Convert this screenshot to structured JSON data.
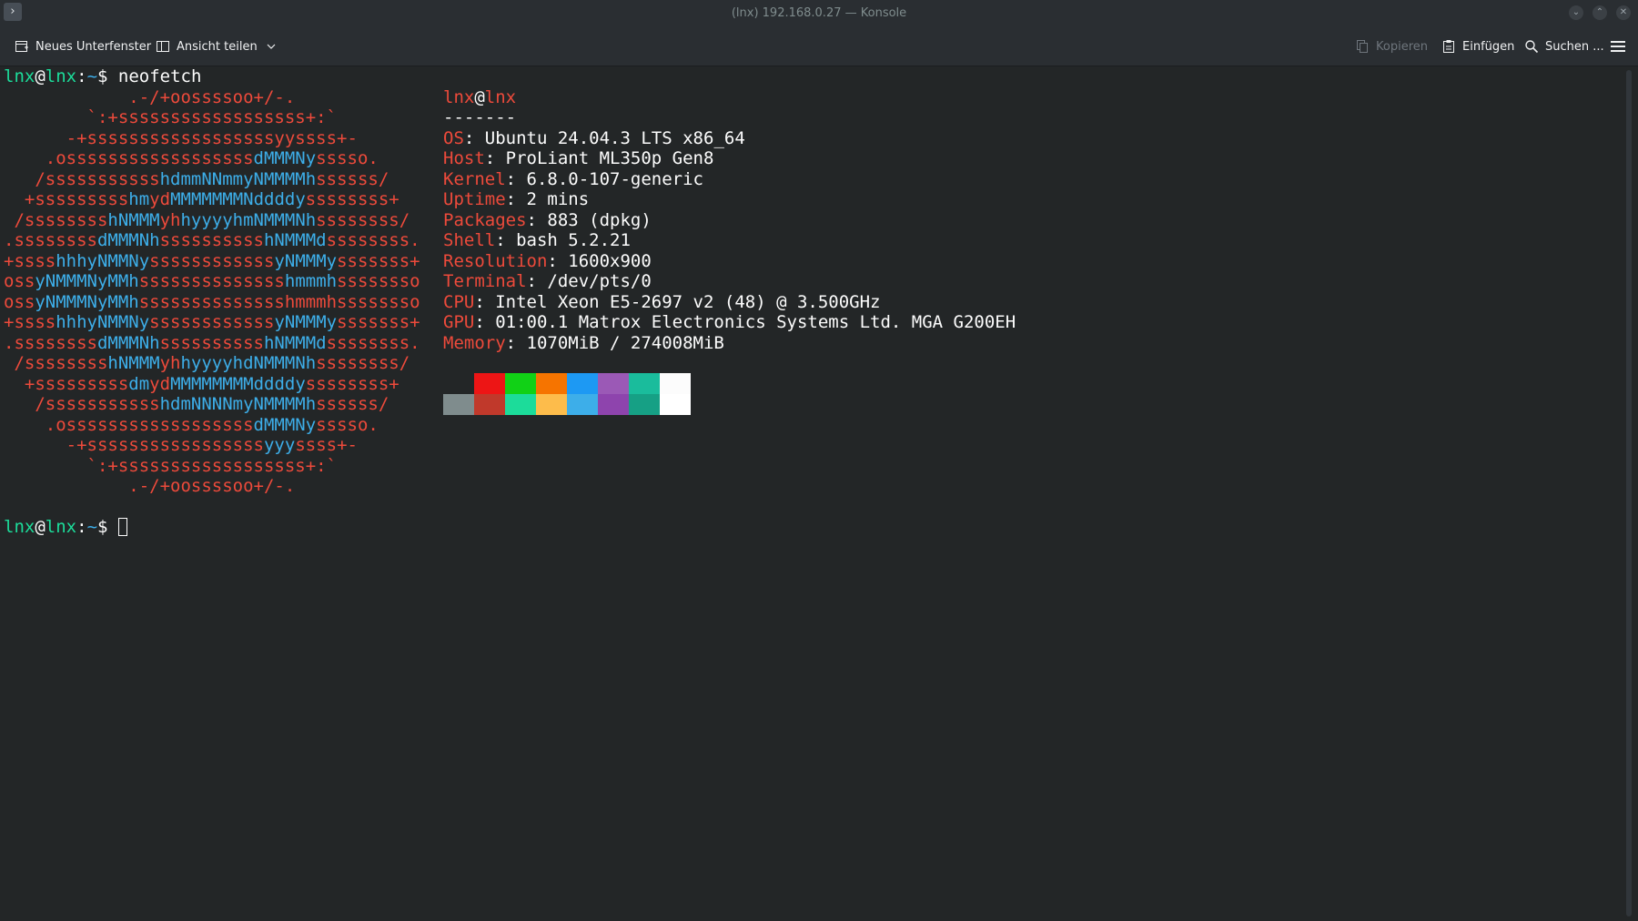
{
  "window": {
    "title": "(lnx) 192.168.0.27 — Konsole",
    "app_icon": "terminal-prompt-icon"
  },
  "window_buttons": [
    {
      "name": "minimize-button",
      "glyph": "⌄"
    },
    {
      "name": "maximize-button",
      "glyph": "⌃"
    },
    {
      "name": "close-button",
      "glyph": "✕"
    }
  ],
  "toolbar": {
    "new_tab": "Neues Unterfenster",
    "split_view": "Ansicht teilen",
    "copy": "Kopieren",
    "paste": "Einfügen",
    "search": "Suchen ...",
    "menu_icon": "hamburger-menu-icon"
  },
  "terminal": {
    "command_line": {
      "user": "lnx",
      "at": "@",
      "host": "lnx",
      "colon": ":",
      "path": "~",
      "dollar": "$ ",
      "command": "neofetch"
    },
    "art": [
      [
        [
          "r",
          "            .-/+oossssoo+/-."
        ]
      ],
      [
        [
          "r",
          "        `:+ssssssssssssssssss+:`"
        ]
      ],
      [
        [
          "r",
          "      -+ssssssssssssssssssyyssss+-"
        ]
      ],
      [
        [
          "r",
          "    .ossssssssssssssssss"
        ],
        [
          "b",
          "dMMMNy"
        ],
        [
          "r",
          "sssso."
        ]
      ],
      [
        [
          "r",
          "   /sssssssssss"
        ],
        [
          "b",
          "hdmmNNmmyNMMMMh"
        ],
        [
          "r",
          "ssssss/"
        ]
      ],
      [
        [
          "r",
          "  +sssssssss"
        ],
        [
          "b",
          "hm"
        ],
        [
          "r",
          "yd"
        ],
        [
          "b",
          "MMMMMMMNddddy"
        ],
        [
          "r",
          "ssssssss+"
        ]
      ],
      [
        [
          "r",
          " /ssssssss"
        ],
        [
          "b",
          "hNMMM"
        ],
        [
          "r",
          "yh"
        ],
        [
          "b",
          "hyyyyhmNMMMNh"
        ],
        [
          "r",
          "ssssssss/"
        ]
      ],
      [
        [
          "r",
          ".ssssssss"
        ],
        [
          "b",
          "dMMMNh"
        ],
        [
          "r",
          "ssssssssss"
        ],
        [
          "b",
          "hNMMMd"
        ],
        [
          "r",
          "ssssssss."
        ]
      ],
      [
        [
          "r",
          "+ssss"
        ],
        [
          "b",
          "hhhyNMMNy"
        ],
        [
          "r",
          "ssssssssssss"
        ],
        [
          "b",
          "yNMMMy"
        ],
        [
          "r",
          "sssssss+"
        ]
      ],
      [
        [
          "r",
          "oss"
        ],
        [
          "b",
          "yNMMMNyMMh"
        ],
        [
          "r",
          "ssssssssssssss"
        ],
        [
          "b",
          "hmmmh"
        ],
        [
          "r",
          "ssssssso"
        ]
      ],
      [
        [
          "r",
          "oss"
        ],
        [
          "b",
          "yNMMMNyMMh"
        ],
        [
          "r",
          "sssssssssssssshmmmhssssssso"
        ]
      ],
      [
        [
          "r",
          "+ssss"
        ],
        [
          "b",
          "hhhyNMMNy"
        ],
        [
          "r",
          "ssssssssssss"
        ],
        [
          "b",
          "yNMMMy"
        ],
        [
          "r",
          "sssssss+"
        ]
      ],
      [
        [
          "r",
          ".ssssssss"
        ],
        [
          "b",
          "dMMMNh"
        ],
        [
          "r",
          "ssssssssss"
        ],
        [
          "b",
          "hNMMMd"
        ],
        [
          "r",
          "ssssssss."
        ]
      ],
      [
        [
          "r",
          " /ssssssss"
        ],
        [
          "b",
          "hNMMM"
        ],
        [
          "r",
          "yh"
        ],
        [
          "b",
          "hyyyyhdNMMMNh"
        ],
        [
          "r",
          "ssssssss/"
        ]
      ],
      [
        [
          "r",
          "  +sssssssss"
        ],
        [
          "b",
          "dm"
        ],
        [
          "r",
          "yd"
        ],
        [
          "b",
          "MMMMMMMMddddy"
        ],
        [
          "r",
          "ssssssss+"
        ]
      ],
      [
        [
          "r",
          "   /sssssssssss"
        ],
        [
          "b",
          "hdmNNNNmyNMMMMh"
        ],
        [
          "r",
          "ssssss/"
        ]
      ],
      [
        [
          "r",
          "    .ossssssssssssssssss"
        ],
        [
          "b",
          "dMMMNy"
        ],
        [
          "r",
          "sssso."
        ]
      ],
      [
        [
          "r",
          "      -+sssssssssssssssss"
        ],
        [
          "b",
          "yyy"
        ],
        [
          "r",
          "ssss+-"
        ]
      ],
      [
        [
          "r",
          "        `:+ssssssssssssssssss+:`"
        ]
      ],
      [
        [
          "r",
          "            .-/+oossssoo+/-."
        ]
      ]
    ],
    "info": {
      "user": "lnx",
      "at": "@",
      "host": "lnx",
      "separator": "-------",
      "fields": [
        {
          "key": "OS",
          "value": "Ubuntu 24.04.3 LTS x86_64"
        },
        {
          "key": "Host",
          "value": "ProLiant ML350p Gen8"
        },
        {
          "key": "Kernel",
          "value": "6.8.0-107-generic"
        },
        {
          "key": "Uptime",
          "value": "2 mins"
        },
        {
          "key": "Packages",
          "value": "883 (dpkg)"
        },
        {
          "key": "Shell",
          "value": "bash 5.2.21"
        },
        {
          "key": "Resolution",
          "value": "1600x900"
        },
        {
          "key": "Terminal",
          "value": "/dev/pts/0"
        },
        {
          "key": "CPU",
          "value": "Intel Xeon E5-2697 v2 (48) @ 3.500GHz"
        },
        {
          "key": "GPU",
          "value": "01:00.1 Matrox Electronics Systems Ltd. MGA G200EH"
        },
        {
          "key": "Memory",
          "value": "1070MiB / 274008MiB"
        }
      ],
      "palette_top": [
        "#232627",
        "#ed1515",
        "#11d116",
        "#f67400",
        "#1d99f3",
        "#9b59b6",
        "#1abc9c",
        "#fcfcfc"
      ],
      "palette_bottom": [
        "#7f8c8d",
        "#c0392b",
        "#1cdc9a",
        "#fdbc4b",
        "#3daee9",
        "#8e44ad",
        "#16a085",
        "#ffffff"
      ]
    },
    "prompt_line": {
      "user": "lnx",
      "at": "@",
      "host": "lnx",
      "colon": ":",
      "path": "~",
      "dollar": "$ "
    }
  }
}
